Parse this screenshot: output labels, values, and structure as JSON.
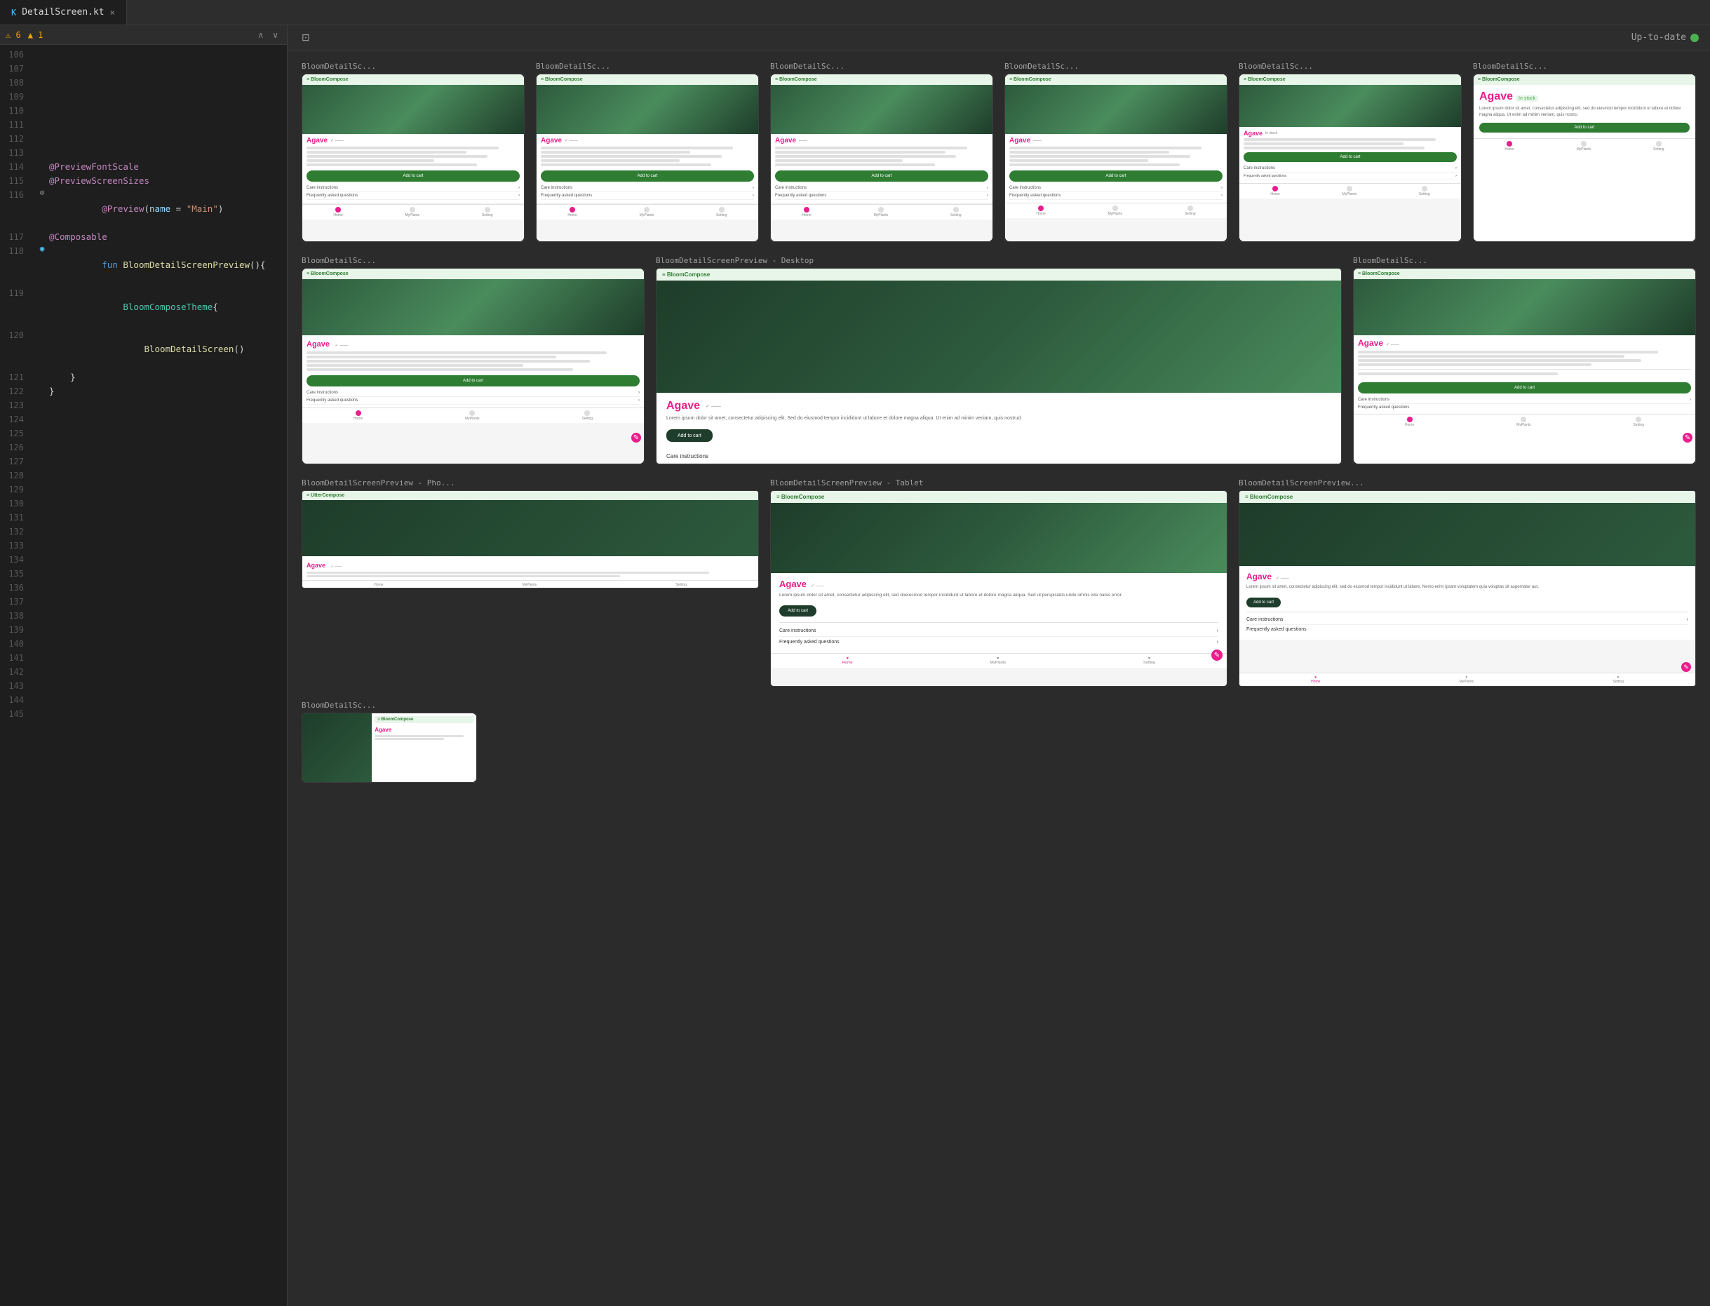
{
  "tab": {
    "icon": "kt",
    "filename": "DetailScreen.kt",
    "close_label": "×"
  },
  "code": {
    "warnings": {
      "error_count": "6",
      "warning_count": "1",
      "error_icon": "⚠",
      "warning_icon": "▲"
    },
    "lines": [
      {
        "num": "106",
        "gutter": "",
        "content": ""
      },
      {
        "num": "107",
        "gutter": "",
        "content": ""
      },
      {
        "num": "108",
        "gutter": "",
        "content": ""
      },
      {
        "num": "109",
        "gutter": "",
        "content": ""
      },
      {
        "num": "110",
        "gutter": "",
        "content": ""
      },
      {
        "num": "111",
        "gutter": "",
        "content": ""
      },
      {
        "num": "112",
        "gutter": "",
        "content": ""
      },
      {
        "num": "113",
        "gutter": "",
        "content": ""
      },
      {
        "num": "114",
        "gutter": "none",
        "content": "@PreviewFontScale",
        "type": "annotation"
      },
      {
        "num": "115",
        "gutter": "none",
        "content": "@PreviewScreenSizes",
        "type": "annotation"
      },
      {
        "num": "116",
        "gutter": "gear",
        "content": "@Preview(name = \"Main\")",
        "type": "annotation"
      },
      {
        "num": "117",
        "gutter": "none",
        "content": "@Composable",
        "type": "annotation"
      },
      {
        "num": "118",
        "gutter": "compose",
        "content": "fun BloomDetailScreenPreview(){",
        "type": "function"
      },
      {
        "num": "119",
        "gutter": "none",
        "content": "    BloomComposeTheme{",
        "type": "class"
      },
      {
        "num": "120",
        "gutter": "none",
        "content": "        BloomDetailScreen()",
        "type": "function"
      },
      {
        "num": "121",
        "gutter": "none",
        "content": "    }",
        "type": "plain"
      },
      {
        "num": "122",
        "gutter": "none",
        "content": "}",
        "type": "plain"
      },
      {
        "num": "123",
        "gutter": "",
        "content": ""
      },
      {
        "num": "124",
        "gutter": "",
        "content": ""
      },
      {
        "num": "125",
        "gutter": "",
        "content": ""
      },
      {
        "num": "126",
        "gutter": "",
        "content": ""
      },
      {
        "num": "127",
        "gutter": "",
        "content": ""
      },
      {
        "num": "128",
        "gutter": "",
        "content": ""
      },
      {
        "num": "129",
        "gutter": "",
        "content": ""
      },
      {
        "num": "130",
        "gutter": "",
        "content": ""
      },
      {
        "num": "131",
        "gutter": "",
        "content": ""
      },
      {
        "num": "132",
        "gutter": "",
        "content": ""
      },
      {
        "num": "133",
        "gutter": "",
        "content": ""
      },
      {
        "num": "134",
        "gutter": "",
        "content": ""
      },
      {
        "num": "135",
        "gutter": "",
        "content": ""
      },
      {
        "num": "136",
        "gutter": "",
        "content": ""
      },
      {
        "num": "137",
        "gutter": "",
        "content": ""
      },
      {
        "num": "138",
        "gutter": "",
        "content": ""
      },
      {
        "num": "139",
        "gutter": "",
        "content": ""
      },
      {
        "num": "140",
        "gutter": "",
        "content": ""
      },
      {
        "num": "141",
        "gutter": "",
        "content": ""
      },
      {
        "num": "142",
        "gutter": "",
        "content": ""
      },
      {
        "num": "143",
        "gutter": "",
        "content": ""
      },
      {
        "num": "144",
        "gutter": "",
        "content": ""
      },
      {
        "num": "145",
        "gutter": "",
        "content": ""
      }
    ]
  },
  "preview": {
    "status_text": "Up-to-date",
    "status_icon": "✓",
    "previews_row1": [
      {
        "label": "BloomDetailSc...",
        "type": "phone_default"
      },
      {
        "label": "BloomDetailSc...",
        "type": "phone_default"
      },
      {
        "label": "BloomDetailSc...",
        "type": "phone_default"
      },
      {
        "label": "BloomDetailSc...",
        "type": "phone_default"
      },
      {
        "label": "BloomDetailSc...",
        "type": "phone_default"
      },
      {
        "label": "BloomDetailSc...",
        "type": "phone_instock"
      }
    ],
    "previews_row2_left": {
      "label": "BloomDetailSc...",
      "type": "phone_small"
    },
    "previews_row2_center": {
      "label": "BloomDetailScreenPreview - Desktop",
      "type": "desktop"
    },
    "previews_row2_right": {
      "label": "BloomDetailSc...",
      "type": "phone_tall"
    },
    "previews_row3": [
      {
        "label": "BloomDetailScreenPreview - Pho...",
        "type": "phone_landscape"
      },
      {
        "label": "BloomDetailScreenPreview - Tablet",
        "type": "tablet"
      },
      {
        "label": "BloomDetailScreenPreview...",
        "type": "tablet_alt"
      }
    ],
    "previews_row4": [
      {
        "label": "BloomDetailSc...",
        "type": "phone_small2"
      }
    ],
    "plant_name": "Agave",
    "plant_subtitle": "In stock",
    "care_instructions": "Care instructions",
    "frequently_asked": "Frequently asked questions",
    "add_to_cart": "Add to cart",
    "home_label": "Home",
    "my_plants_label": "MyPlants",
    "settings_label": "Setting"
  }
}
